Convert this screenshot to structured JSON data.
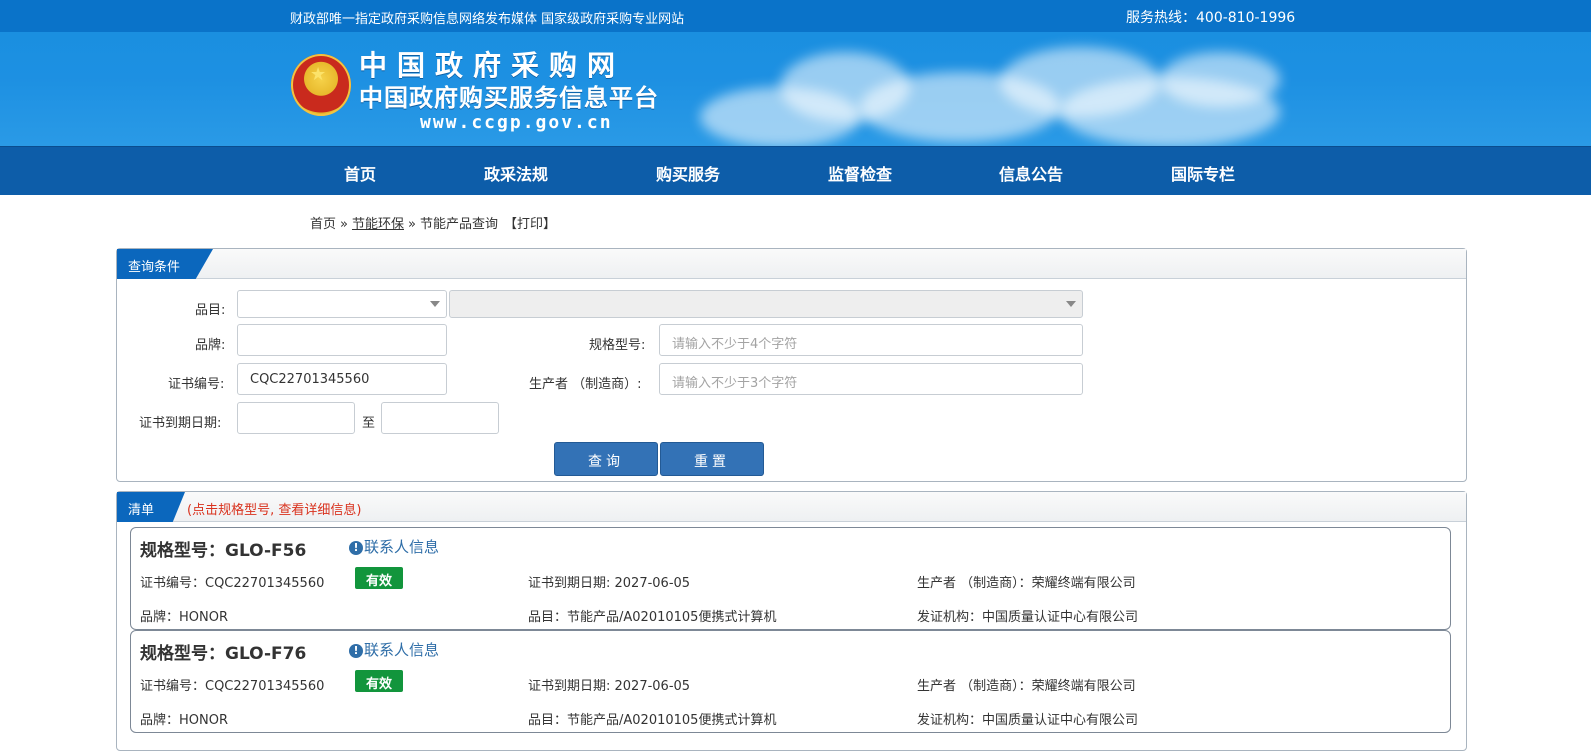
{
  "topbar": {
    "slogan": "财政部唯一指定政府采购信息网络发布媒体 国家级政府采购专业网站",
    "hotline": "服务热线：400-810-1996"
  },
  "logo": {
    "title": "中国政府采购网",
    "subtitle": "中国政府购买服务信息平台",
    "url": "www.ccgp.gov.cn"
  },
  "nav": {
    "items": [
      "首页",
      "政采法规",
      "购买服务",
      "监督检查",
      "信息公告",
      "国际专栏"
    ]
  },
  "breadcrumb": {
    "home": "首页",
    "sep1": "»",
    "section": "节能环保",
    "sep2": "»",
    "current": "节能产品查询",
    "print": "【打印】"
  },
  "query": {
    "panel_title": "查询条件",
    "category_label": "品目:",
    "brand_label": "品牌:",
    "brand_value": "",
    "model_label": "规格型号:",
    "model_placeholder": "请输入不少于4个字符",
    "cert_label": "证书编号:",
    "cert_value": "CQC22701345560",
    "maker_label": "生产者 （制造商）:",
    "maker_placeholder": "请输入不少于3个字符",
    "expire_label": "证书到期日期:",
    "expire_to": "至",
    "search_button": "查询",
    "reset_button": "重置"
  },
  "list": {
    "panel_title": "清单",
    "note": "(点击规格型号, 查看详细信息)",
    "contact_label": "联系人信息",
    "items": [
      {
        "model": "规格型号：GLO-F56",
        "cert_no": "证书编号：CQC22701345560",
        "status": "有效",
        "expire": "证书到期日期: 2027-06-05",
        "maker": "生产者 （制造商）：荣耀终端有限公司",
        "brand": "品牌：HONOR",
        "category": "品目：节能产品/A02010105便携式计算机",
        "issuer": "发证机构：中国质量认证中心有限公司"
      },
      {
        "model": "规格型号：GLO-F76",
        "cert_no": "证书编号：CQC22701345560",
        "status": "有效",
        "expire": "证书到期日期: 2027-06-05",
        "maker": "生产者 （制造商）：荣耀终端有限公司",
        "brand": "品牌：HONOR",
        "category": "品目：节能产品/A02010105便携式计算机",
        "issuer": "发证机构：中国质量认证中心有限公司"
      }
    ]
  },
  "colors": {
    "topbar": "#0a73c9",
    "nav": "#0d5da9",
    "button": "#3372b6",
    "valid_badge": "#12953c",
    "note": "#d9321e"
  }
}
